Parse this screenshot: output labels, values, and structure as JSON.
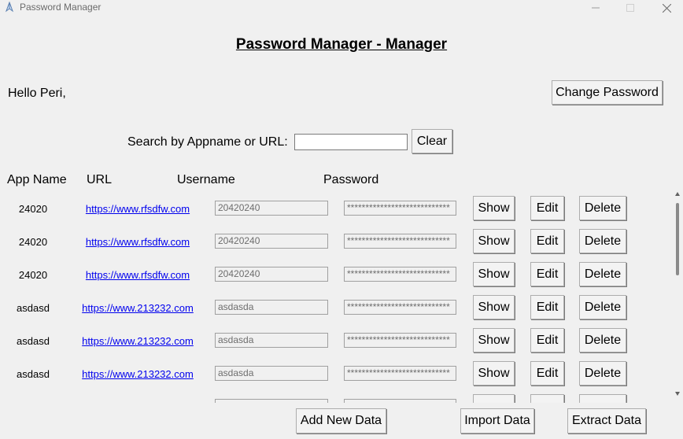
{
  "window": {
    "title": "Password Manager",
    "icon": "app-feather-icon",
    "controls": {
      "minimize": "—",
      "maximize": "☐",
      "close": "✕"
    }
  },
  "header": {
    "title": "Password Manager - Manager"
  },
  "greeting": "Hello Peri,",
  "change_password_label": "Change Password",
  "search": {
    "label": "Search by Appname or URL:",
    "value": "",
    "placeholder": "",
    "clear_label": "Clear"
  },
  "columns": {
    "app": "App Name",
    "url": "URL",
    "username": "Username",
    "password": "Password"
  },
  "rows": [
    {
      "app": "24020",
      "url": "https://www.rfsdfw.com",
      "username": "20420240",
      "password": "****************************",
      "show": "Show",
      "edit": "Edit",
      "delete": "Delete"
    },
    {
      "app": "24020",
      "url": "https://www.rfsdfw.com",
      "username": "20420240",
      "password": "****************************",
      "show": "Show",
      "edit": "Edit",
      "delete": "Delete"
    },
    {
      "app": "24020",
      "url": "https://www.rfsdfw.com",
      "username": "20420240",
      "password": "****************************",
      "show": "Show",
      "edit": "Edit",
      "delete": "Delete"
    },
    {
      "app": "asdasd",
      "url": "https://www.213232.com",
      "username": "asdasda",
      "password": "****************************",
      "show": "Show",
      "edit": "Edit",
      "delete": "Delete"
    },
    {
      "app": "asdasd",
      "url": "https://www.213232.com",
      "username": "asdasda",
      "password": "****************************",
      "show": "Show",
      "edit": "Edit",
      "delete": "Delete"
    },
    {
      "app": "asdasd",
      "url": "https://www.213232.com",
      "username": "asdasda",
      "password": "****************************",
      "show": "Show",
      "edit": "Edit",
      "delete": "Delete"
    },
    {
      "app": "",
      "url": "",
      "username": "",
      "password": "",
      "show": "",
      "edit": "",
      "delete": ""
    }
  ],
  "footer": {
    "add_label": "Add New Data",
    "import_label": "Import Data",
    "extract_label": "Extract Data"
  },
  "scrollbar": {
    "position": 0.0
  },
  "colors": {
    "background": "#f0f0f0",
    "link": "#0000ee",
    "button_bg": "#f3f3f3",
    "button_border": "#adadad"
  }
}
